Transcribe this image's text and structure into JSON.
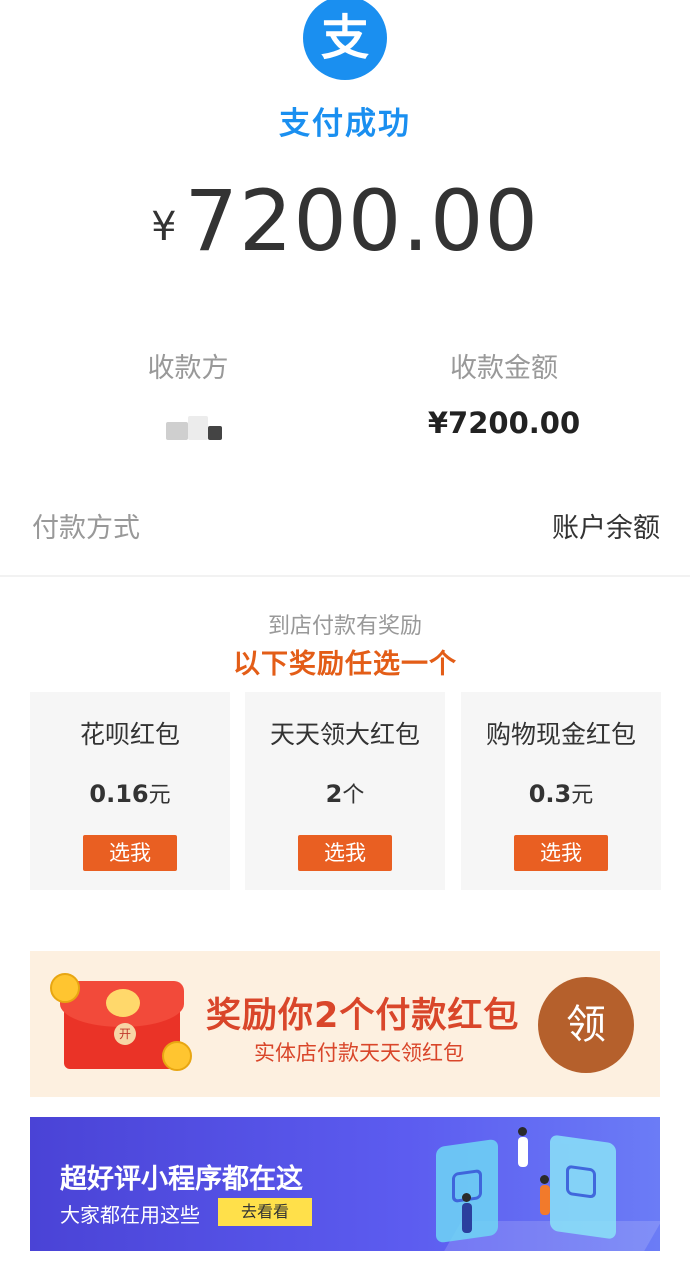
{
  "header": {
    "logo_glyph": "支",
    "status": "支付成功",
    "currency": "¥",
    "amount": "7200.00"
  },
  "details": {
    "payee_label": "收款方",
    "amount_label": "收款金额",
    "amount_value": "¥7200.00",
    "payment_method_label": "付款方式",
    "payment_method_value": "账户余额"
  },
  "rewards": {
    "subtitle": "到店付款有奖励",
    "title": "以下奖励任选一个",
    "cards": [
      {
        "name": "花呗红包",
        "value": "0.16",
        "unit": "元",
        "button": "选我"
      },
      {
        "name": "天天领大红包",
        "value": "2",
        "unit": "个",
        "button": "选我"
      },
      {
        "name": "购物现金红包",
        "value": "0.3",
        "unit": "元",
        "button": "选我"
      }
    ]
  },
  "banner_redpacket": {
    "title": "奖励你2个付款红包",
    "subtitle": "实体店付款天天领红包",
    "claim_button": "领",
    "seal_text": "开"
  },
  "banner_miniprogram": {
    "title": "超好评小程序都在这",
    "subtitle": "大家都在用这些",
    "button": "去看看"
  },
  "colors": {
    "brand_blue": "#1a8ff0",
    "reward_orange": "#e35d17",
    "button_orange": "#e95f22",
    "claim_brown": "#b5602c",
    "banner_purple": "#4a43d6"
  }
}
